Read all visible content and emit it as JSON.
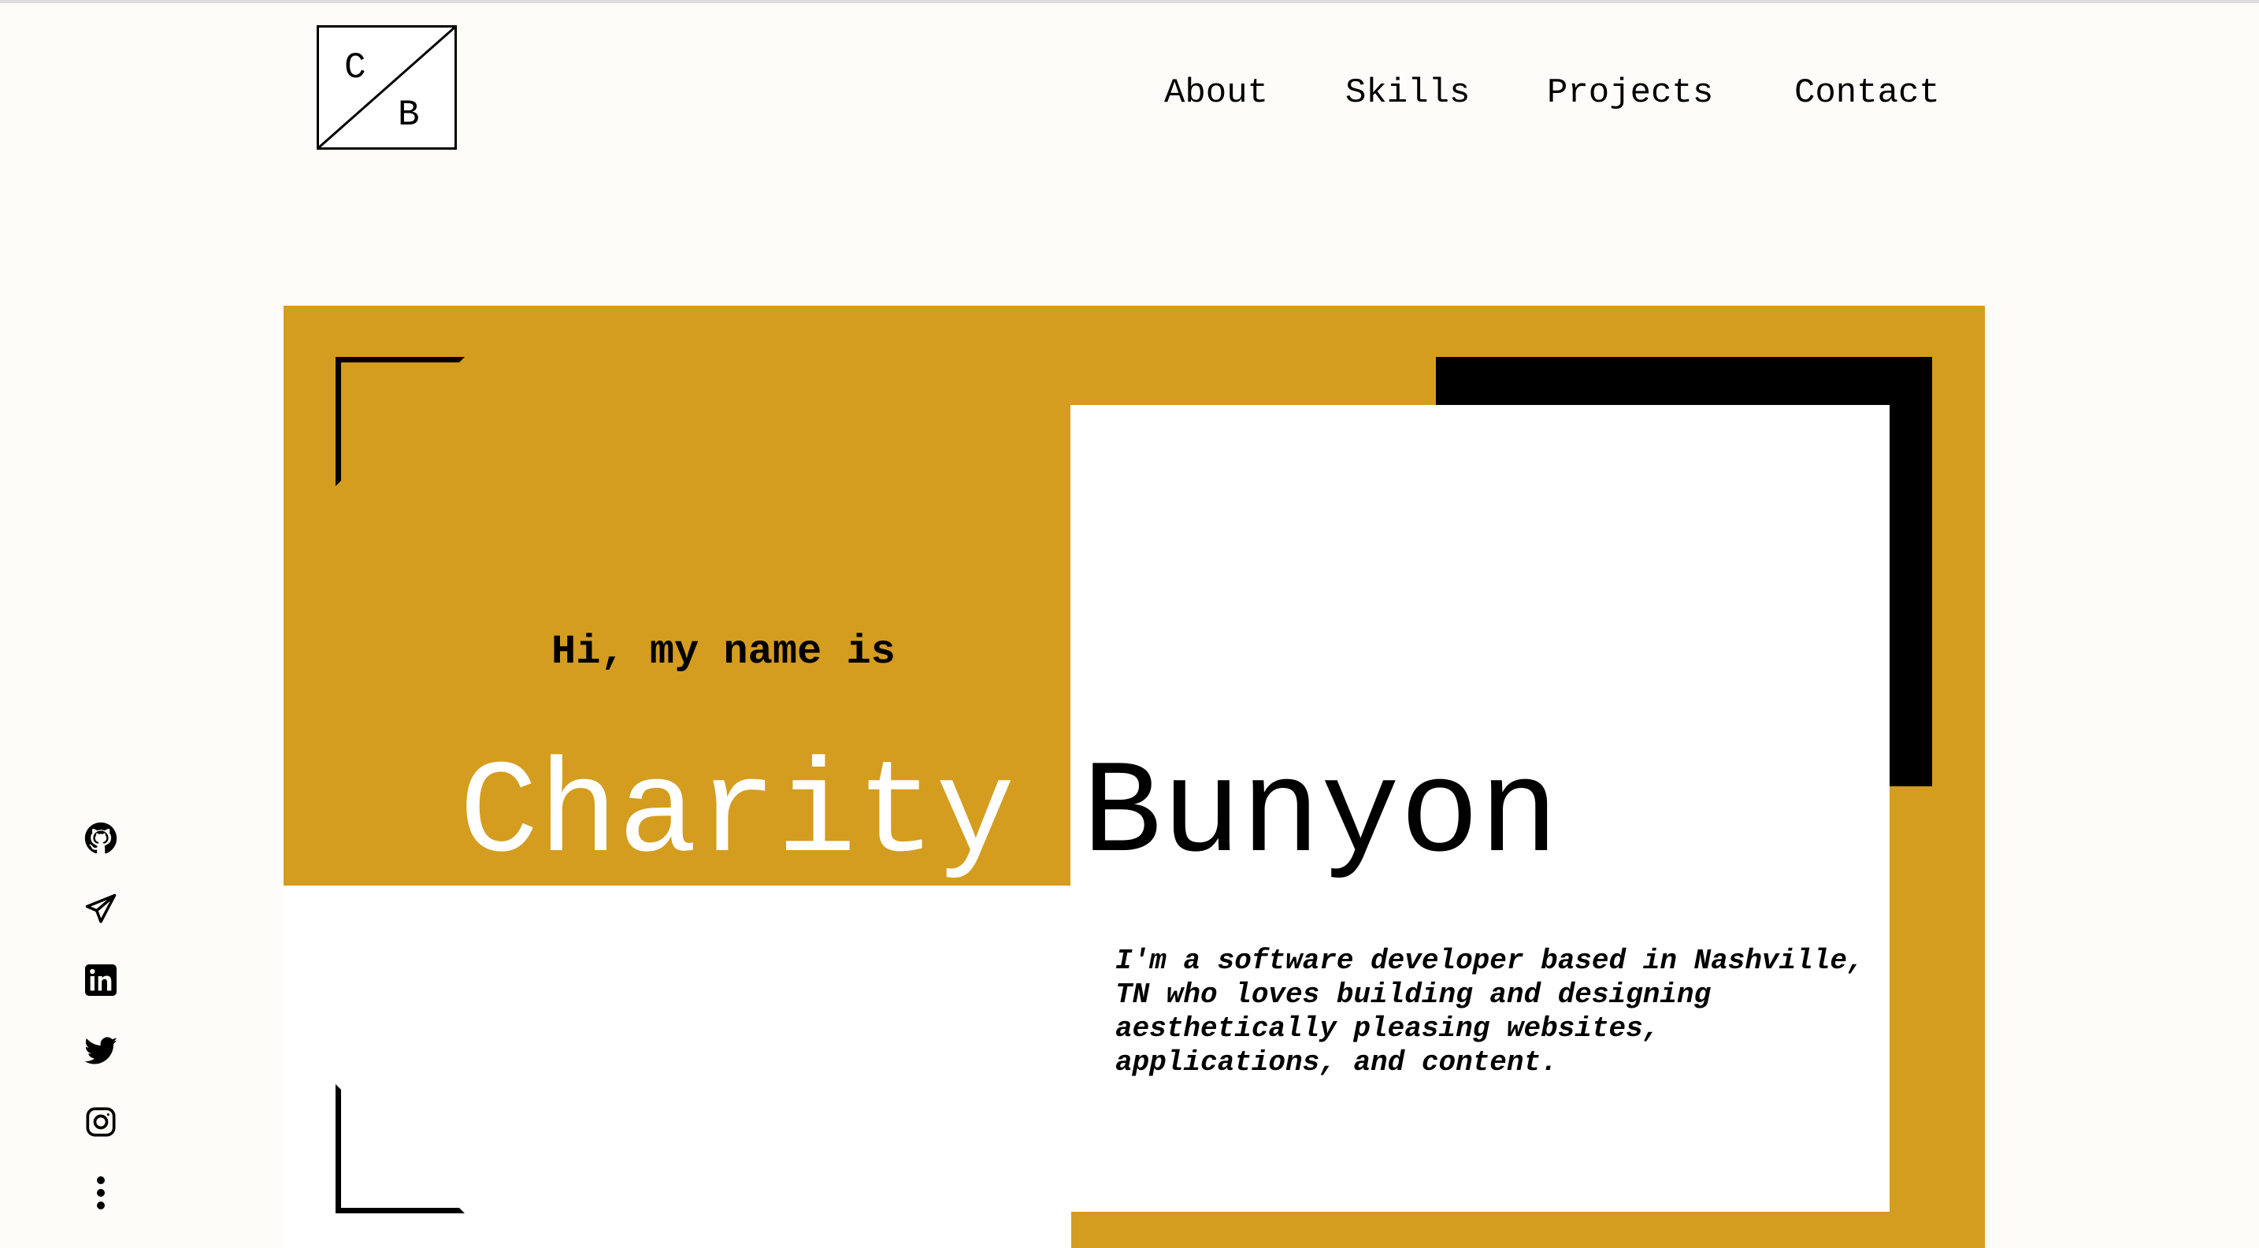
{
  "logo": {
    "letter_top": "C",
    "letter_bottom": "B"
  },
  "nav": {
    "items": [
      {
        "label": "About"
      },
      {
        "label": "Skills"
      },
      {
        "label": "Projects"
      },
      {
        "label": "Contact"
      }
    ]
  },
  "hero": {
    "greeting": "Hi, my name is",
    "first_name": "Charity",
    "last_name": "Bunyon",
    "bio": "I'm a software developer based in Nashville, TN who loves building and designing aesthetically pleasing websites, applications, and content."
  },
  "social": {
    "icons": [
      "github-icon",
      "telegram-icon",
      "linkedin-icon",
      "twitter-icon",
      "instagram-icon",
      "more-vertical-icon"
    ]
  },
  "colors": {
    "accent": "#d49d1f",
    "background": "#fdfcf9",
    "card": "#ffffff",
    "text": "#000000"
  }
}
